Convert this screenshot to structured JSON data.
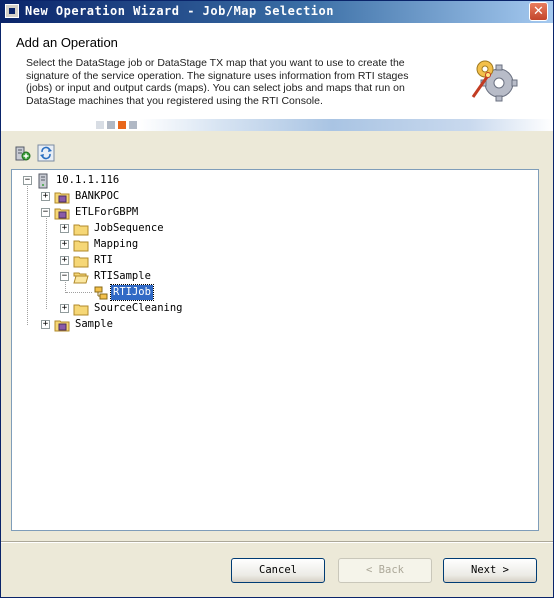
{
  "window": {
    "title": "New Operation Wizard - Job/Map Selection",
    "close_glyph": "✕"
  },
  "header": {
    "title": "Add an Operation",
    "description": "Select the DataStage job or DataStage TX map that you want to use to create the signature of the service operation. The signature uses information from RTI stages (jobs) or input and output cards (maps). You can select jobs and maps that run on DataStage machines that you registered using the RTI Console.",
    "graphic_icon": "wizard-gears-icon"
  },
  "toolbar": {
    "icons": [
      "add-server-icon",
      "refresh-icon"
    ]
  },
  "tree": {
    "root": {
      "label": "10.1.1.116",
      "expander": "−",
      "icon": "server-icon"
    },
    "projects": [
      {
        "label": "BANKPOC",
        "expander": "+",
        "icon": "project-icon"
      },
      {
        "label": "ETLForGBPM",
        "expander": "−",
        "icon": "project-icon"
      },
      {
        "label": "Sample",
        "expander": "+",
        "icon": "project-icon"
      }
    ],
    "etl_folders": [
      {
        "label": "JobSequence",
        "expander": "+"
      },
      {
        "label": "Mapping",
        "expander": "+"
      },
      {
        "label": "RTI",
        "expander": "+"
      },
      {
        "label": "RTISample",
        "expander": "−"
      },
      {
        "label": "SourceCleaning",
        "expander": "+"
      }
    ],
    "selected_job": {
      "label": "RTIJob",
      "icon": "job-icon"
    }
  },
  "buttons": {
    "cancel": "Cancel",
    "back": "< Back",
    "next": "Next >"
  },
  "colors": {
    "title_gradient_start": "#0a246a",
    "selection": "#316ac5",
    "folder": "#f6d776",
    "band_orange": "#e8661a",
    "band_gray": "#b0b8c4"
  }
}
